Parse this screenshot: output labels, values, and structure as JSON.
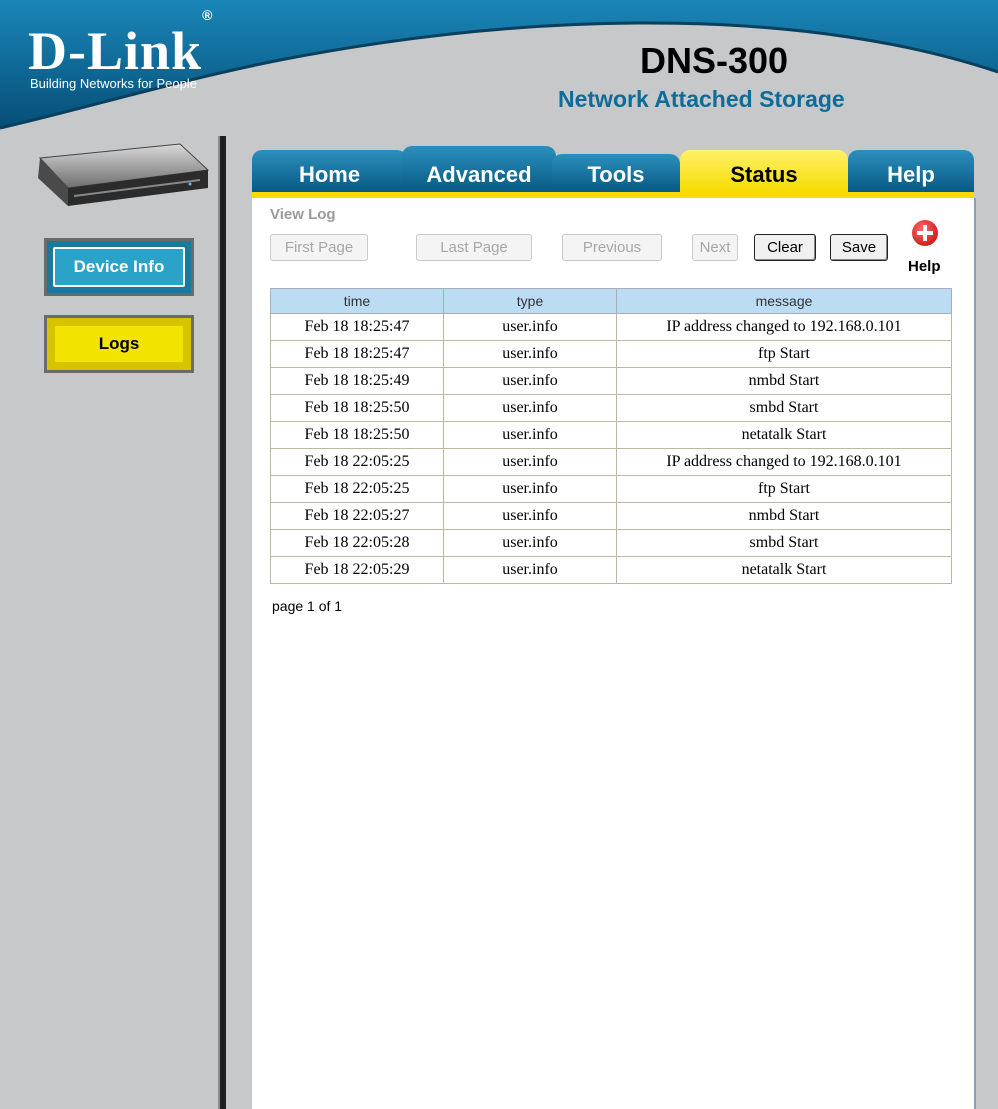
{
  "header": {
    "brand": "D-Link",
    "registered": "®",
    "tagline": "Building Networks for People",
    "model": "DNS-300",
    "subtitle": "Network Attached Storage"
  },
  "sidebar": {
    "items": [
      {
        "label": "Device Info",
        "color": "#2ba3c8"
      },
      {
        "label": "Logs",
        "color": "#f3e300",
        "active": true
      }
    ]
  },
  "tabs": [
    {
      "label": "Home"
    },
    {
      "label": "Advanced"
    },
    {
      "label": "Tools"
    },
    {
      "label": "Status",
      "active": true
    },
    {
      "label": "Help"
    }
  ],
  "main": {
    "section_title": "View Log",
    "buttons": {
      "first": "First Page",
      "last": "Last Page",
      "previous": "Previous",
      "next": "Next",
      "clear": "Clear",
      "save": "Save",
      "help": "Help"
    },
    "columns": [
      "time",
      "type",
      "message"
    ],
    "rows": [
      [
        "Feb 18 18:25:47",
        "user.info",
        "IP address changed to 192.168.0.101"
      ],
      [
        "Feb 18 18:25:47",
        "user.info",
        "ftp Start"
      ],
      [
        "Feb 18 18:25:49",
        "user.info",
        "nmbd Start"
      ],
      [
        "Feb 18 18:25:50",
        "user.info",
        "smbd Start"
      ],
      [
        "Feb 18 18:25:50",
        "user.info",
        "netatalk Start"
      ],
      [
        "Feb 18 22:05:25",
        "user.info",
        "IP address changed to 192.168.0.101"
      ],
      [
        "Feb 18 22:05:25",
        "user.info",
        "ftp Start"
      ],
      [
        "Feb 18 22:05:27",
        "user.info",
        "nmbd Start"
      ],
      [
        "Feb 18 22:05:28",
        "user.info",
        "smbd Start"
      ],
      [
        "Feb 18 22:05:29",
        "user.info",
        "netatalk Start"
      ]
    ],
    "pager": "page 1 of 1"
  },
  "colors": {
    "header_blue": "#0b6a98",
    "tab_active": "#f6dc00",
    "table_header": "#bcdcf4"
  }
}
